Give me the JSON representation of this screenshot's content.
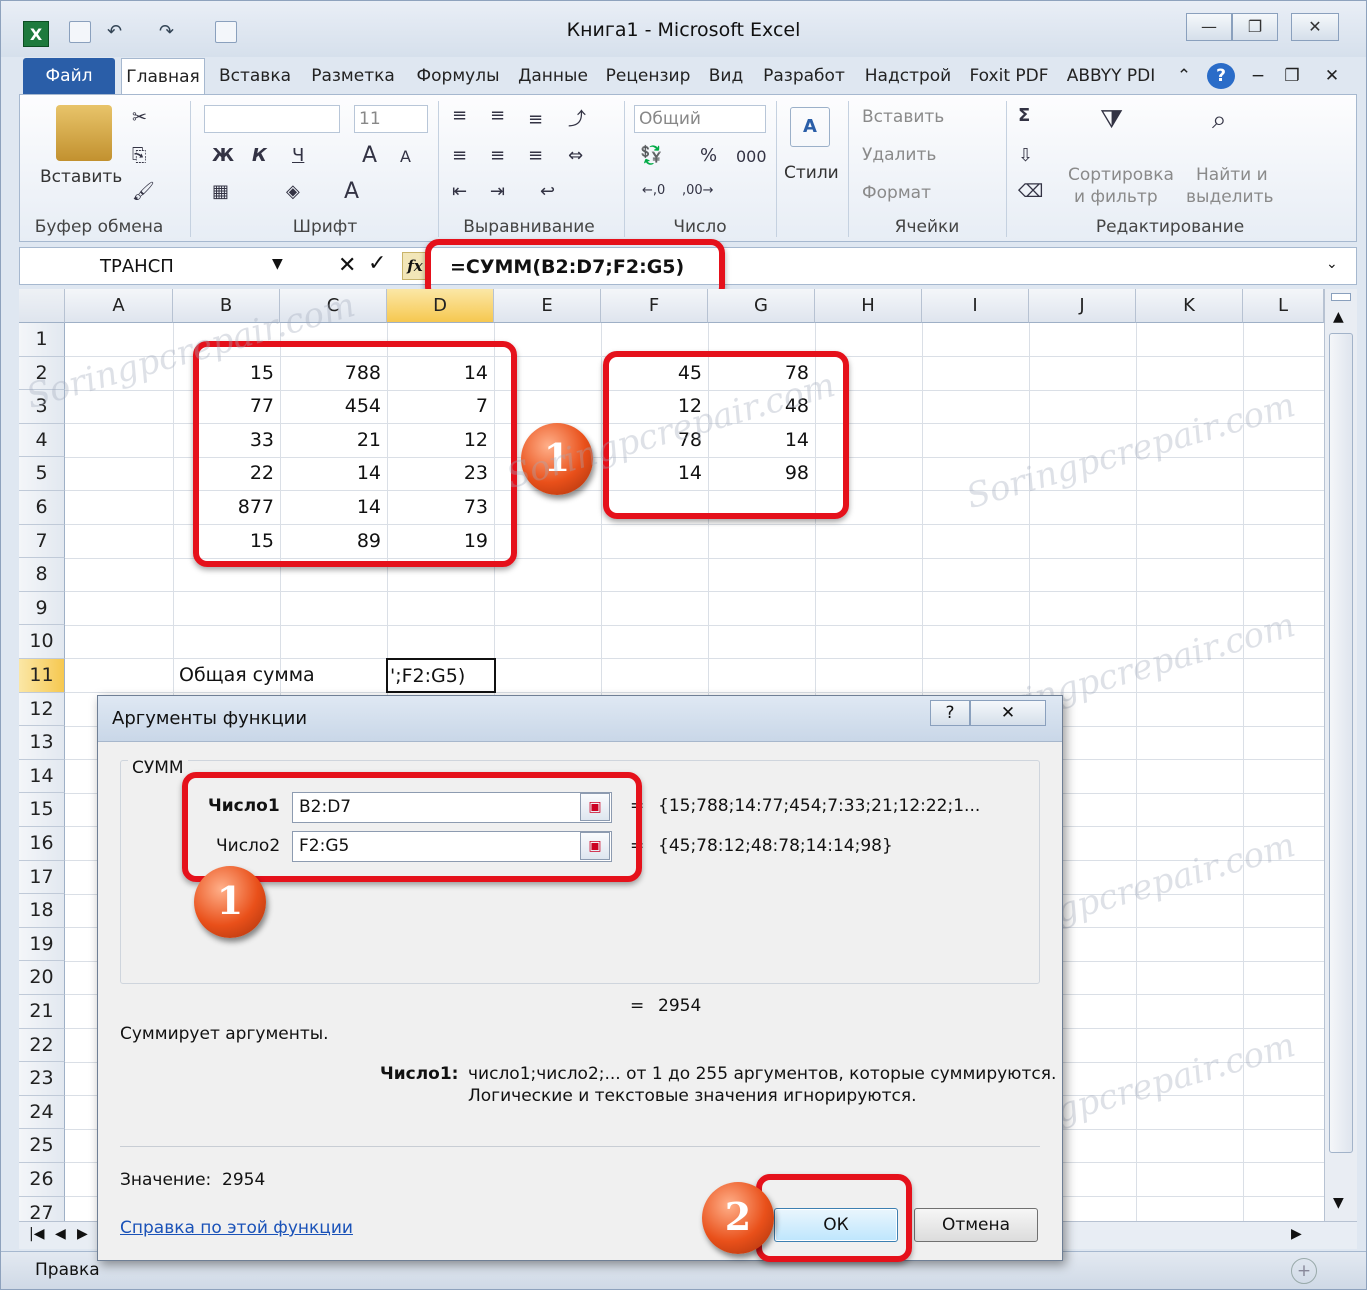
{
  "window": {
    "title": "Книга1  -  Microsoft Excel",
    "app_icon": "X"
  },
  "tabs": [
    "Файл",
    "Главная",
    "Вставка",
    "Разметка",
    "Формулы",
    "Данные",
    "Рецензир",
    "Вид",
    "Разработ",
    "Надстрой",
    "Foxit PDF",
    "ABBYY PDI"
  ],
  "ribbon": {
    "clipboard": {
      "paste": "Вставить",
      "label": "Буфер обмена"
    },
    "font": {
      "size": "11",
      "bold": "Ж",
      "italic": "К",
      "underline": "Ч",
      "grow": "A",
      "shrink": "A",
      "fontcolor": "A",
      "label": "Шрифт"
    },
    "alignment": {
      "label": "Выравнивание"
    },
    "number": {
      "format": "Общий",
      "percent": "%",
      "thousands": "000",
      "label": "Число"
    },
    "styles": {
      "label": "Стили"
    },
    "cells": {
      "insert": "Вставить",
      "delete": "Удалить",
      "format": "Формат",
      "label": "Ячейки"
    },
    "editing": {
      "sum": "Σ",
      "sort1": "Сортировка",
      "sort2": "и фильтр",
      "find1": "Найти и",
      "find2": "выделить",
      "label": "Редактирование"
    }
  },
  "formula_bar": {
    "name_box": "ТРАНСП",
    "fx": "fx",
    "formula": "=СУММ(B2:D7;F2:G5)"
  },
  "columns": [
    "A",
    "B",
    "C",
    "D",
    "E",
    "F",
    "G",
    "H",
    "I",
    "J",
    "K",
    "L"
  ],
  "rows": [
    "1",
    "2",
    "3",
    "4",
    "5",
    "6",
    "7",
    "8",
    "9",
    "10",
    "11",
    "12",
    "13",
    "14",
    "15",
    "16",
    "17",
    "18",
    "19",
    "20",
    "21",
    "22",
    "23",
    "24",
    "25",
    "26",
    "27"
  ],
  "cells": {
    "B": [
      "15",
      "77",
      "33",
      "22",
      "877",
      "15"
    ],
    "C": [
      "788",
      "454",
      "21",
      "14",
      "14",
      "89"
    ],
    "D": [
      "14",
      "7",
      "12",
      "23",
      "73",
      "19"
    ],
    "F": [
      "45",
      "12",
      "78",
      "14"
    ],
    "G": [
      "78",
      "48",
      "14",
      "98"
    ],
    "B11": "Общая сумма",
    "D11": "';F2:G5)"
  },
  "badges": [
    "1",
    "1",
    "2"
  ],
  "dialog": {
    "title": "Аргументы функции",
    "help": "?",
    "close": "✕",
    "func_name": "СУММ",
    "arg1_label": "Число1",
    "arg1_value": "B2:D7",
    "arg1_result": "{15;788;14:77;454;7:33;21;12:22;1...",
    "arg2_label": "Число2",
    "arg2_value": "F2:G5",
    "arg2_result": "{45;78:12;48:78;14:14;98}",
    "eq": "=",
    "result_preview": "2954",
    "description": "Суммирует аргументы.",
    "arg_desc_label": "Число1:",
    "arg_desc_line1": "число1;число2;... от 1 до 255 аргументов, которые суммируются.",
    "arg_desc_line2": "Логические и текстовые значения игнорируются.",
    "value_label": "Значение:",
    "value": "2954",
    "help_link": "Справка по этой функции",
    "ok": "ОК",
    "cancel": "Отмена"
  },
  "status": {
    "mode": "Правка"
  },
  "watermark": "Soringpcrepair.com",
  "colors": {
    "accent": "#2a5ea8",
    "highlight": "#e5111b",
    "badge": "#e9501a",
    "excel_green": "#1e7a3d"
  }
}
